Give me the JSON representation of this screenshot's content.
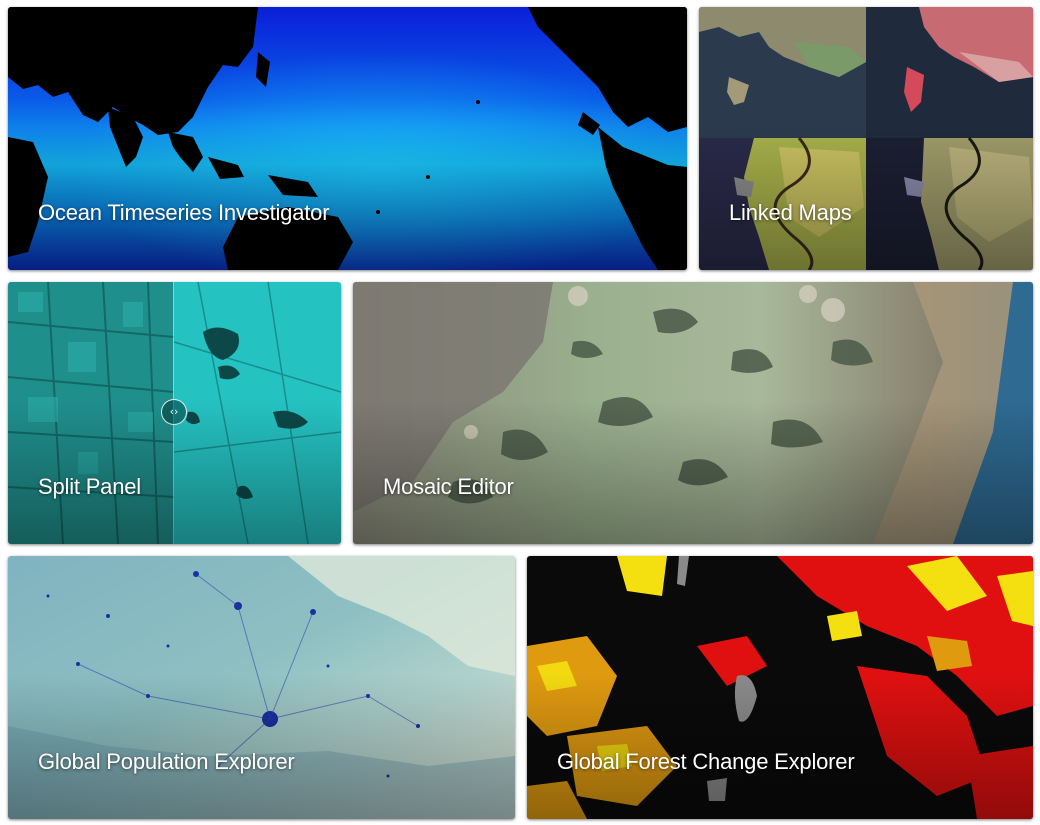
{
  "gallery": {
    "tiles": [
      {
        "id": "ocean-timeseries-investigator",
        "label": "Ocean Timeseries Investigator"
      },
      {
        "id": "linked-maps",
        "label": "Linked Maps"
      },
      {
        "id": "split-panel",
        "label": "Split Panel"
      },
      {
        "id": "mosaic-editor",
        "label": "Mosaic Editor"
      },
      {
        "id": "global-population-explorer",
        "label": "Global Population Explorer"
      },
      {
        "id": "global-forest-change-explorer",
        "label": "Global Forest Change Explorer"
      }
    ],
    "split_handle_icon": "‹›"
  }
}
